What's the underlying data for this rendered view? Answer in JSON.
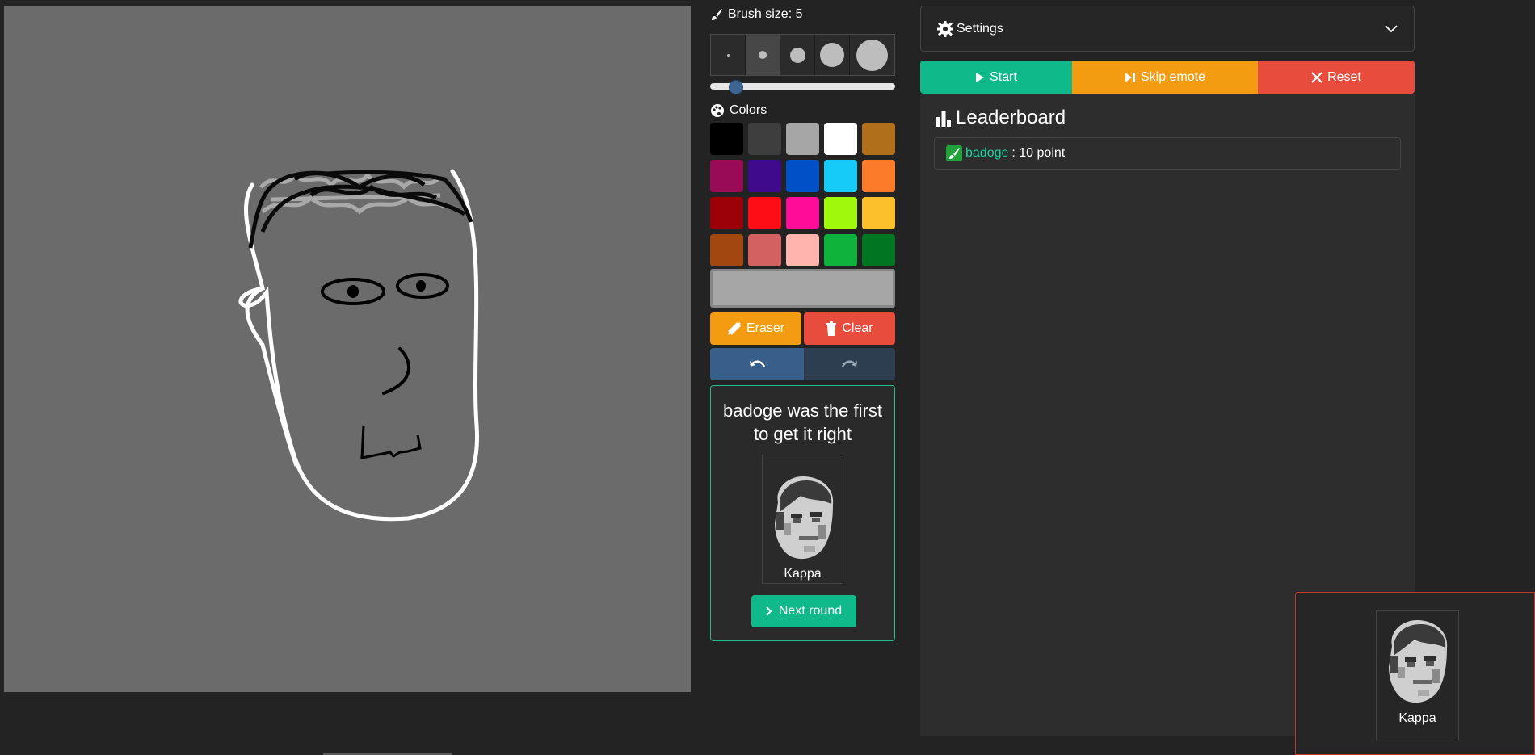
{
  "brush": {
    "label": "Brush size: 5",
    "sizes": [
      1,
      5,
      10,
      15,
      20
    ],
    "active_index": 1,
    "slider_fraction": 0.1
  },
  "colors": {
    "label": "Colors",
    "swatches": [
      "#000000",
      "#3e3e3e",
      "#a6a6a6",
      "#ffffff",
      "#b06f1b",
      "#990b56",
      "#3f0a8c",
      "#0050c8",
      "#16cbf7",
      "#fb7b2a",
      "#9c0006",
      "#ff0d16",
      "#ff0c99",
      "#a0f90a",
      "#fbc02c",
      "#a1470f",
      "#d46161",
      "#ffb4ae",
      "#0fb23b",
      "#017521"
    ],
    "current": "#a6a6a6"
  },
  "tools": {
    "eraser": "Eraser",
    "clear": "Clear"
  },
  "result": {
    "message": "badoge was the first to get it right",
    "emote": "Kappa",
    "next_label": "Next round"
  },
  "settings": {
    "label": "Settings"
  },
  "controls": {
    "start": "Start",
    "skip": "Skip emote",
    "reset": "Reset"
  },
  "leaderboard": {
    "title": "Leaderboard",
    "entries": [
      {
        "player": "badoge",
        "score": ": 10 point"
      }
    ]
  },
  "overlay": {
    "emote": "Kappa"
  }
}
